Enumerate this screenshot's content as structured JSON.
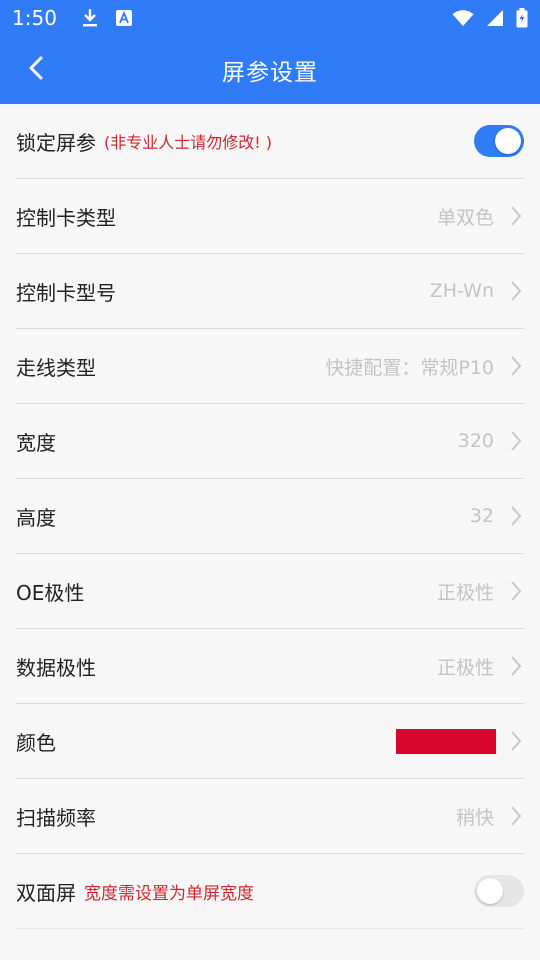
{
  "status_bar": {
    "time": "1:50",
    "icons_left": [
      "download-icon",
      "a-icon"
    ],
    "icons_right": [
      "wifi-icon",
      "signal-icon",
      "battery-icon"
    ]
  },
  "app_bar": {
    "title": "屏参设置",
    "back_icon": "back-chevron-icon",
    "background": "#2f7cf6"
  },
  "settings": {
    "lock": {
      "label": "锁定屏参",
      "warning": "(非专业人士请勿修改! )",
      "toggle_on": true
    },
    "card_type": {
      "label": "控制卡类型",
      "value": "单双色"
    },
    "card_model": {
      "label": "控制卡型号",
      "value": "ZH-Wn"
    },
    "wiring": {
      "label": "走线类型",
      "value": "快捷配置：常规P10"
    },
    "width": {
      "label": "宽度",
      "value": "320"
    },
    "height": {
      "label": "高度",
      "value": "32"
    },
    "oe_polarity": {
      "label": "OE极性",
      "value": "正极性"
    },
    "data_polarity": {
      "label": "数据极性",
      "value": "正极性"
    },
    "color": {
      "label": "颜色",
      "swatch": "#d6052b"
    },
    "scan_rate": {
      "label": "扫描频率",
      "value": "稍快"
    },
    "double_sided": {
      "label": "双面屏",
      "warning": "宽度需设置为单屏宽度",
      "toggle_on": false
    }
  },
  "colors": {
    "accent": "#2f7cf6",
    "warning": "#d0262c",
    "value_text": "#c4c4c4"
  }
}
